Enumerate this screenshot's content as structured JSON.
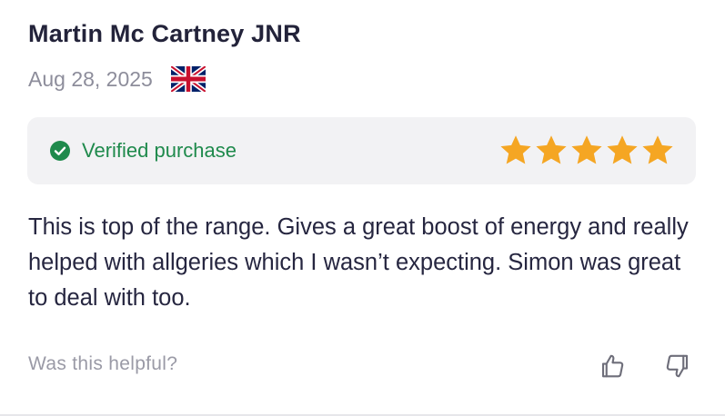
{
  "review": {
    "author": "Martin Mc Cartney JNR",
    "date": "Aug 28, 2025",
    "country_flag_icon": "uk-flag-icon",
    "verified_label": "Verified purchase",
    "verified_icon": "check-circle-icon",
    "rating": 5,
    "rating_max": 5,
    "body": "This is top of the range. Gives a great boost of energy and really helped with allgeries which I wasn’t expecting. Simon was great to deal with too.",
    "helpful_prompt": "Was this helpful?",
    "vote_icons": [
      "thumbs-up-icon",
      "thumbs-down-icon"
    ]
  },
  "colors": {
    "author_text": "#23233a",
    "muted_text": "#8d8d9b",
    "verified_green": "#1f8a4c",
    "star_gold": "#f5a623",
    "verify_bar_bg": "#f2f2f4"
  }
}
